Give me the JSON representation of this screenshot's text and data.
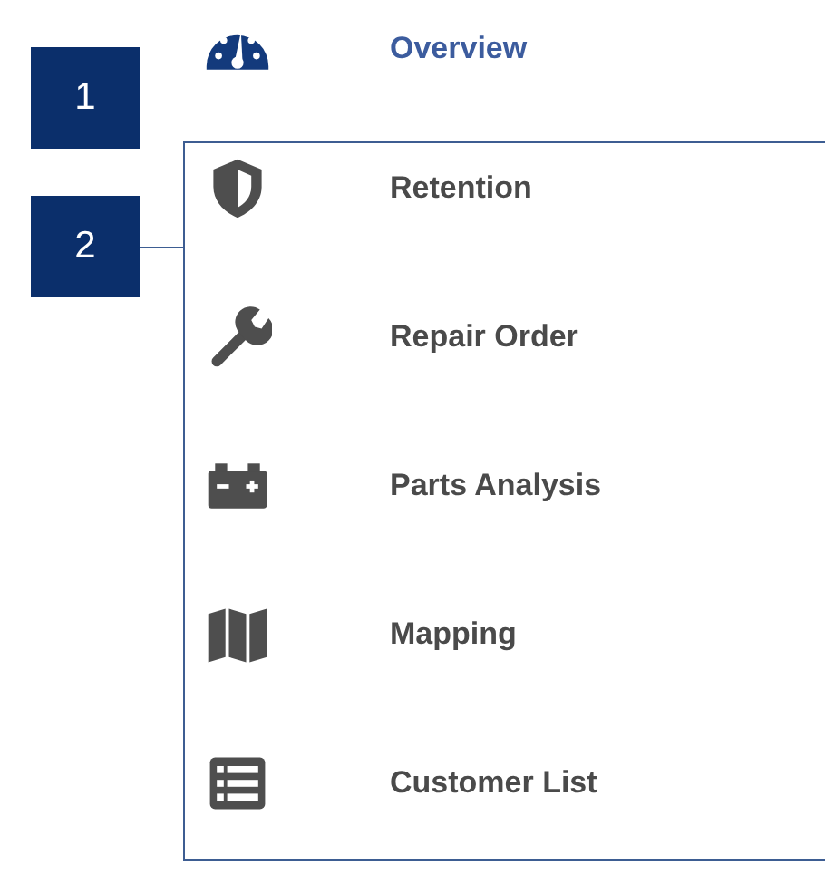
{
  "menu": {
    "items": [
      {
        "label": "Overview",
        "selected": true
      },
      {
        "label": "Retention",
        "selected": false
      },
      {
        "label": "Repair Order",
        "selected": false
      },
      {
        "label": "Parts Analysis",
        "selected": false
      },
      {
        "label": "Mapping",
        "selected": false
      },
      {
        "label": "Customer List",
        "selected": false
      }
    ]
  },
  "callouts": [
    {
      "label": "1",
      "leader": false
    },
    {
      "label": "2",
      "leader": true
    }
  ]
}
